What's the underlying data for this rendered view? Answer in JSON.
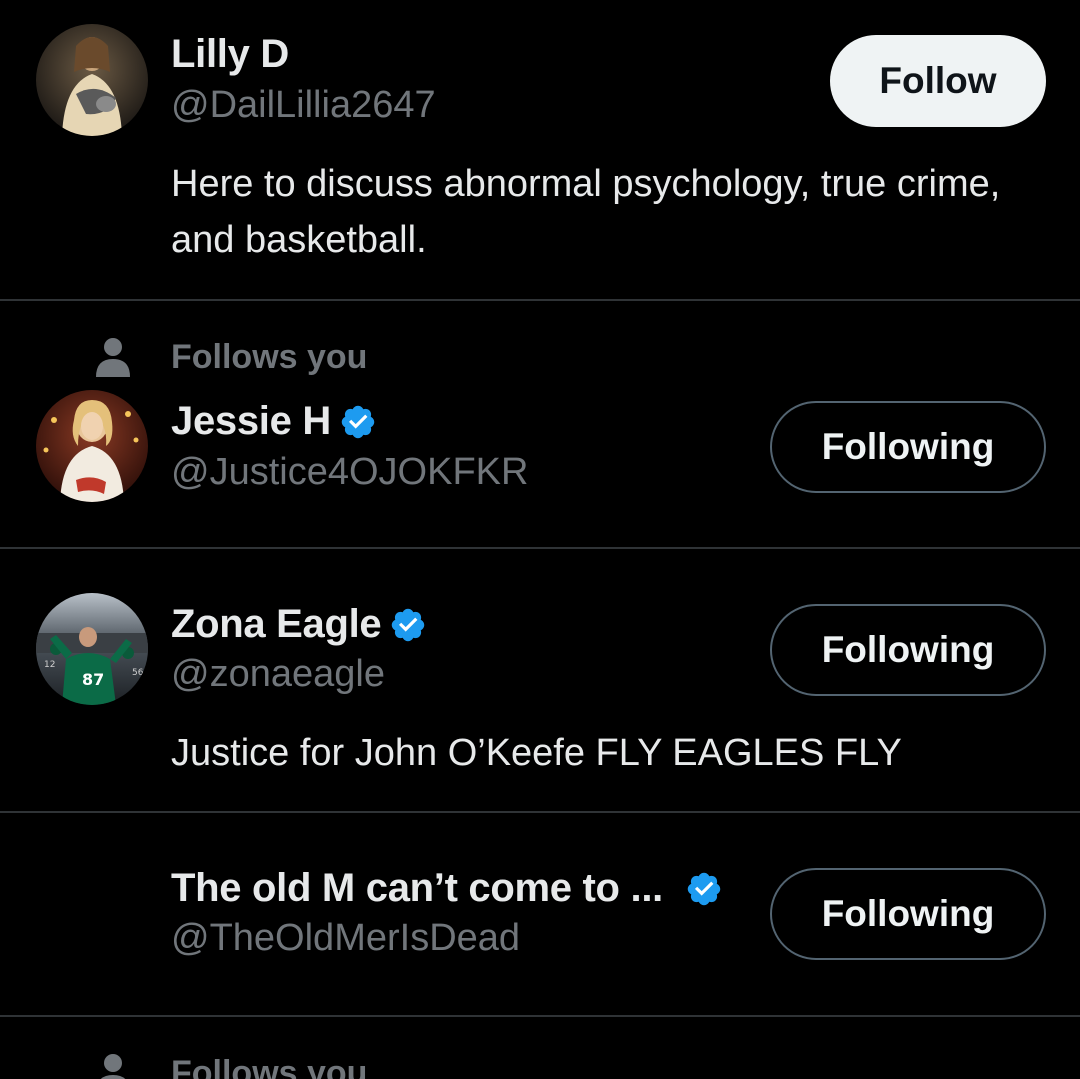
{
  "users": [
    {
      "display_name": "Lilly D",
      "handle": "@DailLillia2647",
      "verified": false,
      "bio": "Here to discuss abnormal psychology, true crime, and basketball.",
      "button_label": "Follow",
      "avatar_icon": "jesus-holding-lamb-portrait"
    },
    {
      "social_context": "Follows you",
      "display_name": "Jessie H",
      "handle": "@Justice4OJOKFKR",
      "verified": true,
      "button_label": "Following",
      "avatar_icon": "woman-in-white-dress-portrait"
    },
    {
      "display_name": "Zona Eagle",
      "handle": "@zonaeagle",
      "verified": true,
      "bio": "Justice for John O’Keefe FLY EAGLES FLY",
      "button_label": "Following",
      "avatar_icon": "eagles-fan-stadium-photo"
    },
    {
      "display_name": "The old M can’t come to ...",
      "handle": "@TheOldMerIsDead",
      "verified": true,
      "button_label": "Following",
      "avatar_icon": "none"
    },
    {
      "social_context": "Follows you"
    }
  ],
  "colors": {
    "background": "#000000",
    "primary_text": "#e7e9ea",
    "secondary_text": "#71767b",
    "verified_blue": "#1d9bf0",
    "divider": "#2f3336",
    "follow_button_bg": "#eff3f4",
    "following_border": "#536471"
  }
}
